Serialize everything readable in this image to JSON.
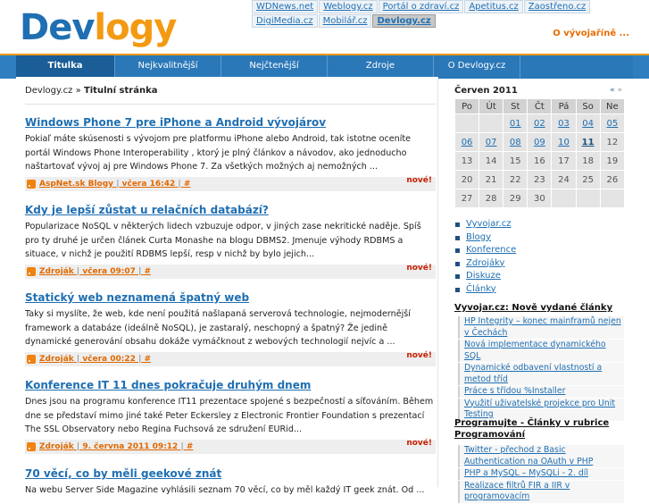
{
  "logo": {
    "part1": "Dev",
    "part2": "logy"
  },
  "network_links": [
    {
      "label": "WDNews.net"
    },
    {
      "label": "Weblogy.cz"
    },
    {
      "label": "Portál o zdraví.cz"
    },
    {
      "label": "Apetitus.cz"
    },
    {
      "label": "Zaostřeno.cz"
    },
    {
      "label": "DigiMedia.cz"
    },
    {
      "label": "Mobilář.cz"
    },
    {
      "label": "Devlogy.cz"
    }
  ],
  "tagline": "O vývojaříně ...",
  "nav": [
    {
      "label": "Titulka"
    },
    {
      "label": "Nejkvalitnější"
    },
    {
      "label": "Nejčtenější"
    },
    {
      "label": "Zdroje"
    },
    {
      "label": "O Devlogy.cz"
    }
  ],
  "breadcrumb": {
    "site": "Devlogy.cz",
    "separator": "»",
    "current": "Titulní stránka"
  },
  "articles": [
    {
      "title": "Windows Phone 7 pre iPhone a Android vývojárov",
      "body": "Pokiaľ máte skúsenosti s vývojom pre platformu iPhone alebo Android, tak istotne oceníte portál Windows Phone Interoperability , ktorý je plný článkov a návodov, ako jednoducho naštartovať vývoj aj pre Windows Phone 7. Za všetkých možných aj nemožných ...",
      "source": "AspNet.sk Blogy",
      "date": "včera 16:42",
      "hash": "#",
      "badge": "nové!"
    },
    {
      "title": "Kdy je lepší zůstat u relačních databází?",
      "body": "Popularizace NoSQL v některých lidech vzbuzuje odpor, v jiných zase nekritické naděje. Spíš pro ty druhé je určen článek Curta Monashe na blogu DBMS2. Jmenuje výhody RDBMS a situace, v nichž je použití RDBMS lepší, resp v nichž by bylo jejich...",
      "source": "Zdroják",
      "date": "včera 09:07",
      "hash": "#",
      "badge": "nové!"
    },
    {
      "title": "Statický web neznamená špatný web",
      "body": "Taky si myslíte, že web, kde není použitá našlapaná serverová technologie, nejmodernější framework a databáze (ideálně NoSQL), je zastaralý, neschopný a špatný? Že jedině dynamické generování obsahu dokáže vymáčknout z webových technologií nejvíc a ...",
      "source": "Zdroják",
      "date": "včera 00:22",
      "hash": "#",
      "badge": "nové!"
    },
    {
      "title": "Konference IT 11 dnes pokračuje druhým dnem",
      "body": "Dnes jsou na programu konference IT11 prezentace spojené s bezpečností a síťováním. Během dne se představí mimo jiné také Peter Eckersley z Electronic Frontier Foundation s prezentací The SSL Observatory nebo Regina Fuchsová ze sdružení EURid...",
      "source": "Zdroják",
      "date": "9. června 2011 09:12",
      "hash": "#",
      "badge": "nové!"
    },
    {
      "title": "70 věcí, co by měli geekové znát",
      "body": "Na webu Server Side Magazine vyhlásili seznam 70 věcí, co by měl každý IT geek znát. Od ...",
      "source": "",
      "date": "",
      "hash": "",
      "badge": ""
    }
  ],
  "calendar": {
    "month": "Červen 2011",
    "prev": "«",
    "next": "»",
    "dow": [
      "Po",
      "Út",
      "St",
      "Čt",
      "Pá",
      "So",
      "Ne"
    ],
    "weeks": [
      [
        "",
        "",
        "01",
        "02",
        "03",
        "04",
        "05"
      ],
      [
        "06",
        "07",
        "08",
        "09",
        "10",
        "11",
        "12"
      ],
      [
        "13",
        "14",
        "15",
        "16",
        "17",
        "18",
        "19"
      ],
      [
        "20",
        "21",
        "22",
        "23",
        "24",
        "25",
        "26"
      ],
      [
        "27",
        "28",
        "29",
        "30",
        "",
        "",
        ""
      ]
    ]
  },
  "categories": [
    {
      "label": "Vyvojar.cz"
    },
    {
      "label": "Blogy"
    },
    {
      "label": "Konference"
    },
    {
      "label": "Zdrojáky"
    },
    {
      "label": "Diskuze"
    },
    {
      "label": "Články"
    }
  ],
  "vyvojar_section": {
    "title": "Vyvojar.cz: Nově vydané články",
    "items": [
      {
        "label": "HP Integrity – konec mainframů nejen v Čechách"
      },
      {
        "label": "Nová implementace dynamického SQL"
      },
      {
        "label": "Dynamické odbavení vlastností a metod tříd"
      },
      {
        "label": "Práce s třídou %Installer"
      },
      {
        "label": "Využití uživatelské projekce pro Unit Testing"
      }
    ]
  },
  "programujte_section": {
    "title": "Programujte - Články v rubrice Programování",
    "items": [
      {
        "label": "Twitter - přechod z Basic Authentication na OAuth v PHP"
      },
      {
        "label": "PHP a MySQL – MySQLi - 2. díl"
      },
      {
        "label": "Realizace filtrů FIR a IIR v programovacím"
      }
    ]
  },
  "colors": {
    "brand_blue": "#1f6fb2",
    "brand_orange": "#f39a12",
    "new_badge": "#c81e00"
  }
}
